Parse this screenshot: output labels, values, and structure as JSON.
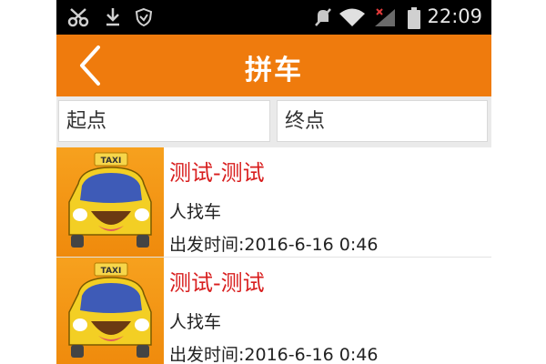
{
  "status_bar": {
    "time": "22:09",
    "icons": [
      "scissors-icon",
      "download-icon",
      "shield-icon",
      "mute-icon",
      "wifi-icon",
      "no-signal-icon",
      "battery-icon"
    ]
  },
  "header": {
    "title": "拼车",
    "back_icon": "chevron-left-icon",
    "background_color": "#ef7b0d"
  },
  "search": {
    "start_placeholder": "起点",
    "end_placeholder": "终点"
  },
  "trips": [
    {
      "name": "测试-测试",
      "type": "人找车",
      "time_label": "出发时间:2016-6-16 0:46",
      "thumb_icon": "taxi-icon"
    },
    {
      "name": "测试-测试",
      "type": "人找车",
      "time_label": "出发时间:2016-6-16 0:46",
      "thumb_icon": "taxi-icon"
    }
  ],
  "colors": {
    "accent": "#ef7b0d",
    "trip_name": "#d81e1e"
  }
}
